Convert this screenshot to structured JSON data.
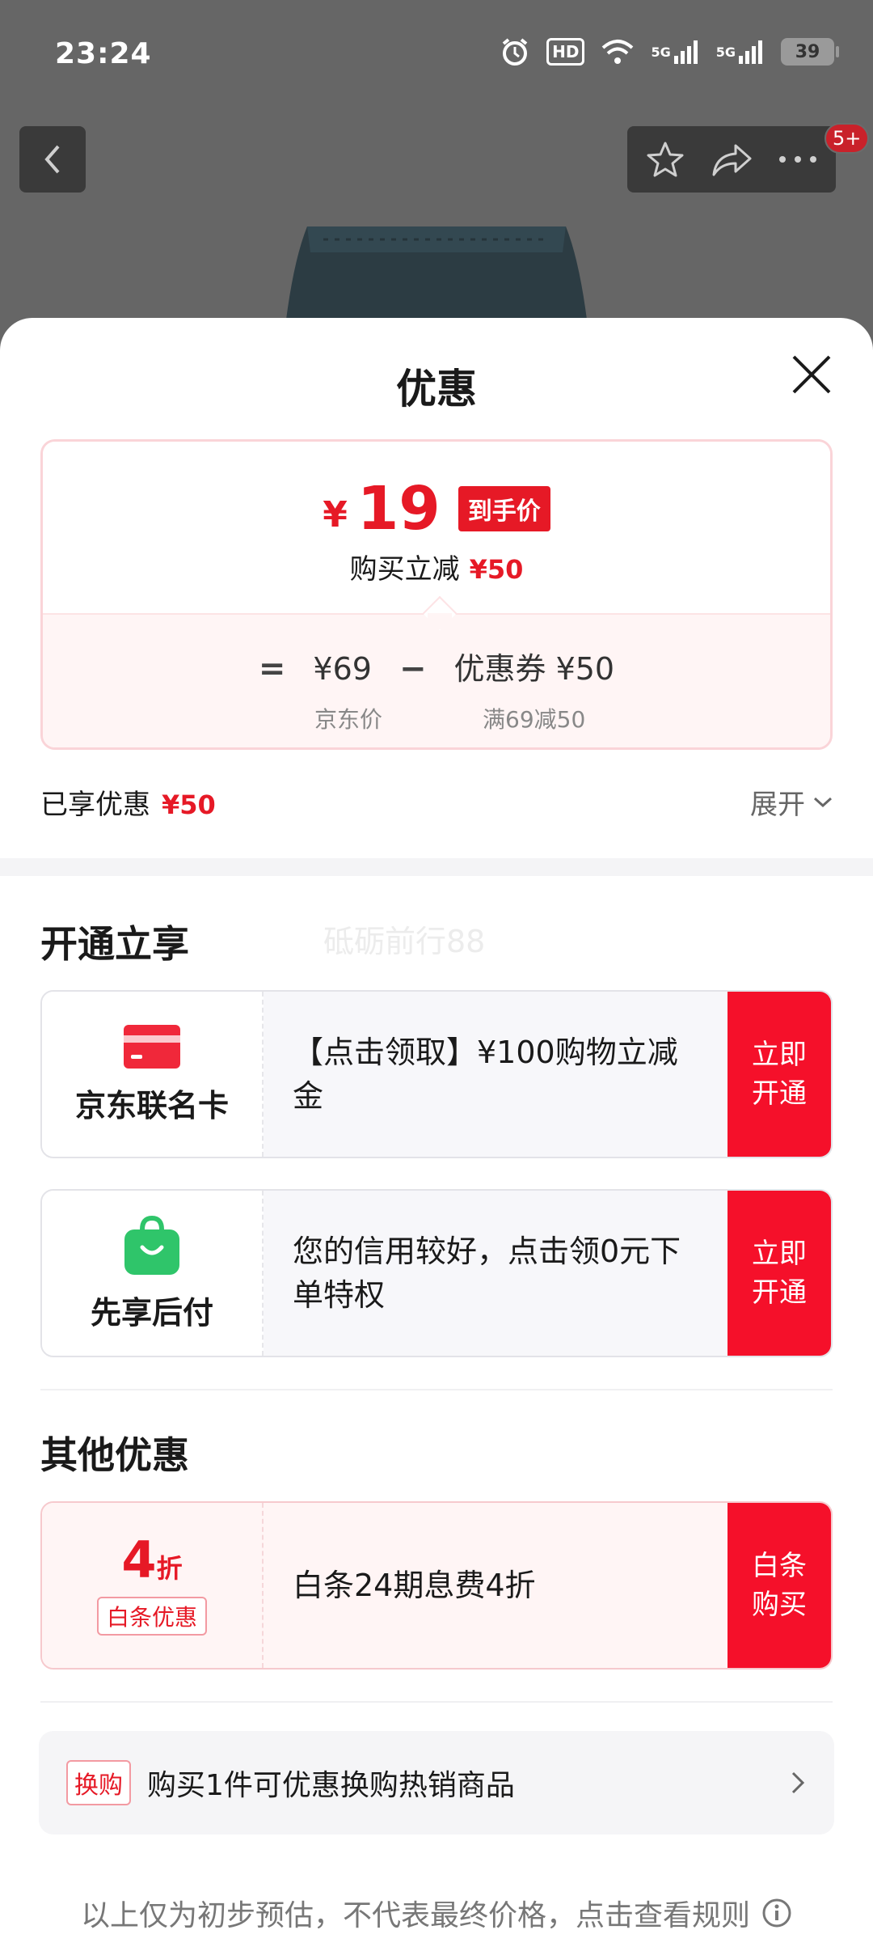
{
  "status_bar": {
    "time": "23:24",
    "hd_label": "HD",
    "net1_label": "5G",
    "net2_label": "5G",
    "battery": "39"
  },
  "nav": {
    "badge": "5+"
  },
  "sheet": {
    "title": "优惠",
    "price_card": {
      "currency": "¥",
      "final_price": "19",
      "final_tag": "到手价",
      "save_label": "购买立减",
      "save_amount": "¥50",
      "equals": "=",
      "jd_price": "¥69",
      "minus": "−",
      "coupon_label": "优惠券",
      "coupon_amount": "¥50",
      "jd_price_caption": "京东价",
      "coupon_caption": "满69减50"
    },
    "enjoyed_label": "已享优惠",
    "enjoyed_amount": "¥50",
    "expand_label": "展开",
    "watermark": "砥砺前行88",
    "open_section": {
      "title": "开通立享",
      "offers": [
        {
          "name": "京东联名卡",
          "desc": "【点击领取】¥100购物立减金",
          "button": "立即开通",
          "icon": "credit-card-icon"
        },
        {
          "name": "先享后付",
          "desc": "您的信用较好，点击领0元下单特权",
          "button": "立即开通",
          "icon": "shopping-bag-icon"
        }
      ]
    },
    "other_section": {
      "title": "其他优惠",
      "offers": [
        {
          "discount_num": "4",
          "discount_unit": "折",
          "tag": "白条优惠",
          "desc": "白条24期息费4折",
          "button": "白条购买"
        }
      ]
    },
    "exchange": {
      "tag": "换购",
      "text": "购买1件可优惠换购热销商品"
    },
    "footer_note": "以上仅为初步预估，不代表最终价格，点击查看规则"
  },
  "colors": {
    "accent_red": "#e61926",
    "button_red": "#f5102a",
    "green": "#2fc56a"
  }
}
